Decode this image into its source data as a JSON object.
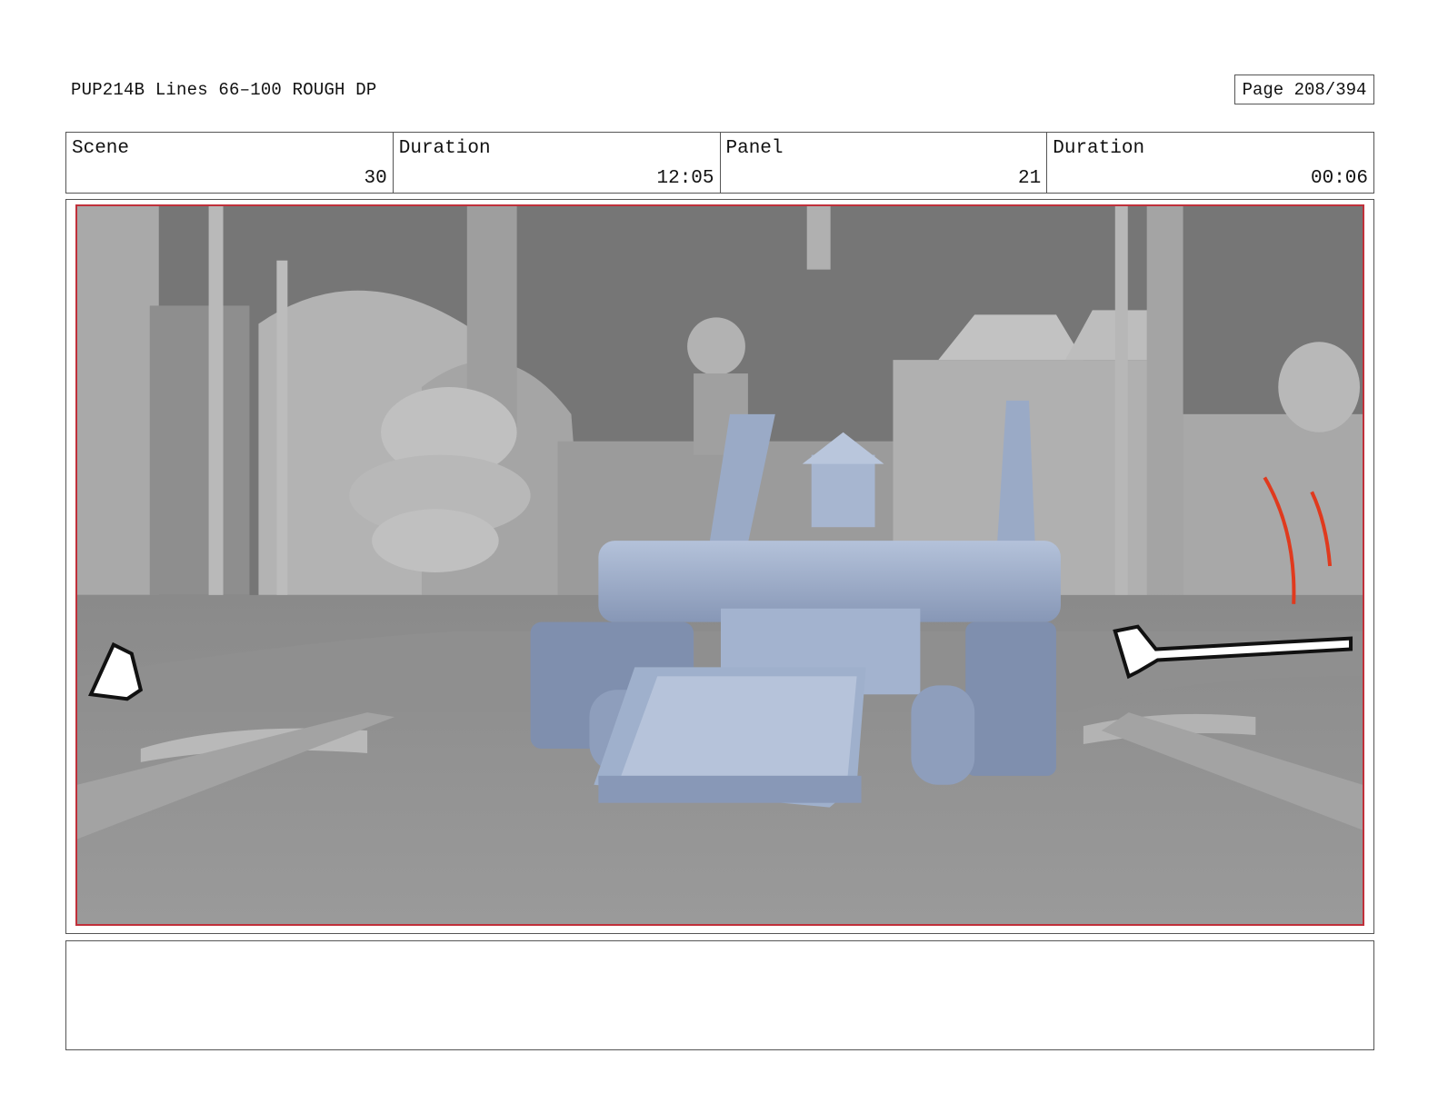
{
  "header": {
    "doc_title": "PUP214B Lines 66–100 ROUGH DP",
    "page_label": "Page 208/394"
  },
  "info": {
    "scene_label": "Scene",
    "scene_value": "30",
    "scene_duration_label": "Duration",
    "scene_duration_value": "12:05",
    "panel_label": "Panel",
    "panel_value": "21",
    "panel_duration_label": "Duration",
    "panel_duration_value": "00:06"
  },
  "notes": {
    "text": ""
  },
  "colors": {
    "panel_border": "#c0303a",
    "vehicle": "#9fb0cc",
    "sketch_red": "#e03a1e"
  }
}
